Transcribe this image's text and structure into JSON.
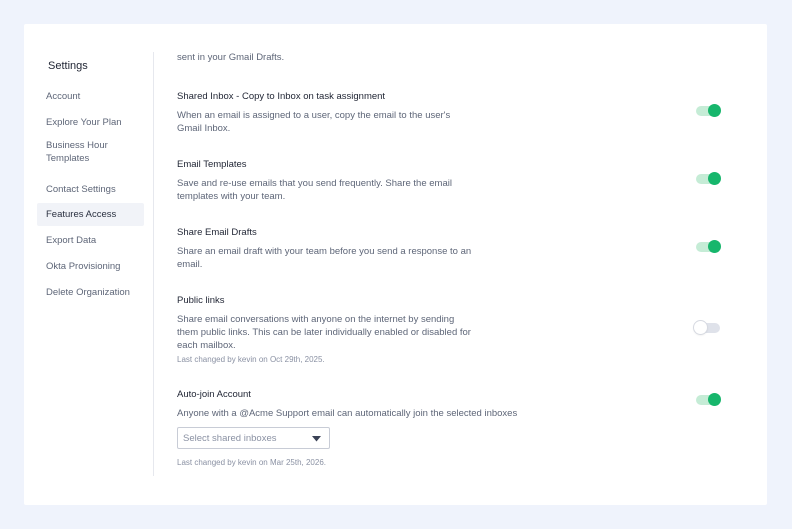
{
  "sidebar": {
    "title": "Settings",
    "items": [
      {
        "label": "Account"
      },
      {
        "label": "Explore Your Plan"
      },
      {
        "label": "Business Hour Templates"
      },
      {
        "label": "Contact Settings"
      },
      {
        "label": "Features Access",
        "active": true
      },
      {
        "label": "Export Data"
      },
      {
        "label": "Okta Provisioning"
      },
      {
        "label": "Delete Organization"
      }
    ]
  },
  "content": {
    "top_text": "sent in your Gmail Drafts.",
    "sections": [
      {
        "title": "Shared Inbox - Copy to Inbox on task assignment",
        "description": "When an email is assigned to a user, copy the email to the user's Gmail Inbox.",
        "enabled": true
      },
      {
        "title": "Email Templates",
        "description": "Save and re-use emails that you send frequently. Share the email templates with your team.",
        "enabled": true
      },
      {
        "title": "Share Email Drafts",
        "description": "Share an email draft with your team before you send a response to an email.",
        "enabled": true
      },
      {
        "title": "Public links",
        "description": "Share email conversations with anyone on the internet by sending them public links. This can be later individually enabled or disabled for each mailbox.",
        "note": "Last changed by kevin on Oct 29th, 2025.",
        "enabled": false
      },
      {
        "title": "Auto-join Account",
        "description": "Anyone with a @Acme Support email can automatically join the selected inboxes",
        "note": "Last changed by kevin on Mar 25th, 2026.",
        "enabled": true,
        "select_placeholder": "Select shared inboxes"
      }
    ]
  },
  "colors": {
    "accent": "#17b66c",
    "toggle_on_track": "#c5ecd6",
    "background": "#eff3fc"
  },
  "icons": {
    "dropdown": "caret-down-icon"
  }
}
